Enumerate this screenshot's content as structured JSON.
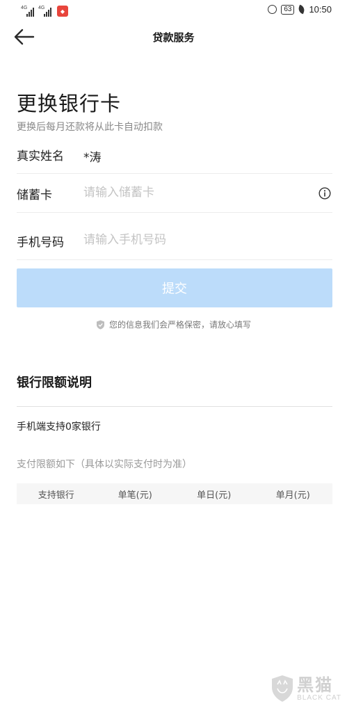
{
  "status_bar": {
    "signal_1": "4G",
    "signal_2": "4G",
    "battery": "63",
    "time": "10:50"
  },
  "nav": {
    "title": "贷款服务",
    "back_icon": "arrow-left-icon"
  },
  "page": {
    "title": "更换银行卡",
    "subtitle": "更换后每月还款将从此卡自动扣款"
  },
  "form": {
    "name_label": "真实姓名",
    "name_value": "*涛",
    "card_label": "储蓄卡",
    "card_placeholder": "请输入储蓄卡",
    "card_value": "",
    "phone_label": "手机号码",
    "phone_placeholder": "请输入手机号码",
    "phone_value": "",
    "submit_label": "提交",
    "privacy_note": "您的信息我们会严格保密，请放心填写"
  },
  "bank_limits": {
    "title": "银行限额说明",
    "support_count": "手机端支持0家银行",
    "note": "支付限额如下（具体以实际支付时为准）",
    "columns": [
      "支持银行",
      "单笔(元)",
      "单日(元)",
      "单月(元)"
    ],
    "rows": []
  },
  "watermark": {
    "text_cn": "黑猫",
    "text_en": "BLACK CAT"
  },
  "colors": {
    "submit_disabled": "#bcdcfa",
    "placeholder": "#c4c4c4",
    "subtitle": "#888888"
  }
}
